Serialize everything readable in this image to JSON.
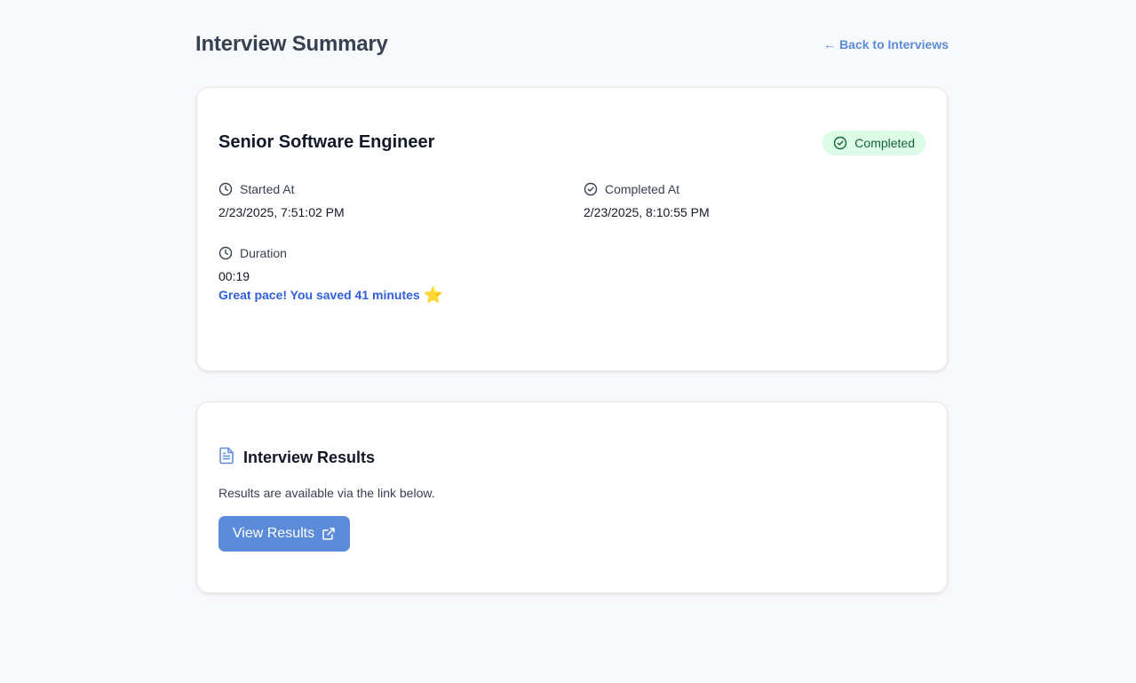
{
  "header": {
    "title": "Interview Summary",
    "back_link_arrow": "←",
    "back_link_label": "Back to Interviews"
  },
  "summary": {
    "job_title": "Senior Software Engineer",
    "status": "Completed",
    "started_at": {
      "label": "Started At",
      "value": "2/23/2025, 7:51:02 PM",
      "icon": "clock-icon"
    },
    "completed_at": {
      "label": "Completed At",
      "value": "2/23/2025, 8:10:55 PM",
      "icon": "check-circle-icon"
    },
    "duration": {
      "label": "Duration",
      "value": "00:19",
      "icon": "clock-icon"
    },
    "pace_note": "Great pace! You saved 41 minutes",
    "pace_emoji": "⭐"
  },
  "results": {
    "title": "Interview Results",
    "icon": "document-icon",
    "description": "Results are available via the link below.",
    "button_label": "View Results",
    "button_icon": "external-link-icon"
  },
  "colors": {
    "accent": "#5b8bd9",
    "badge_bg": "#dcfce7",
    "badge_text": "#166534",
    "pace_text": "#2f5fdb"
  }
}
